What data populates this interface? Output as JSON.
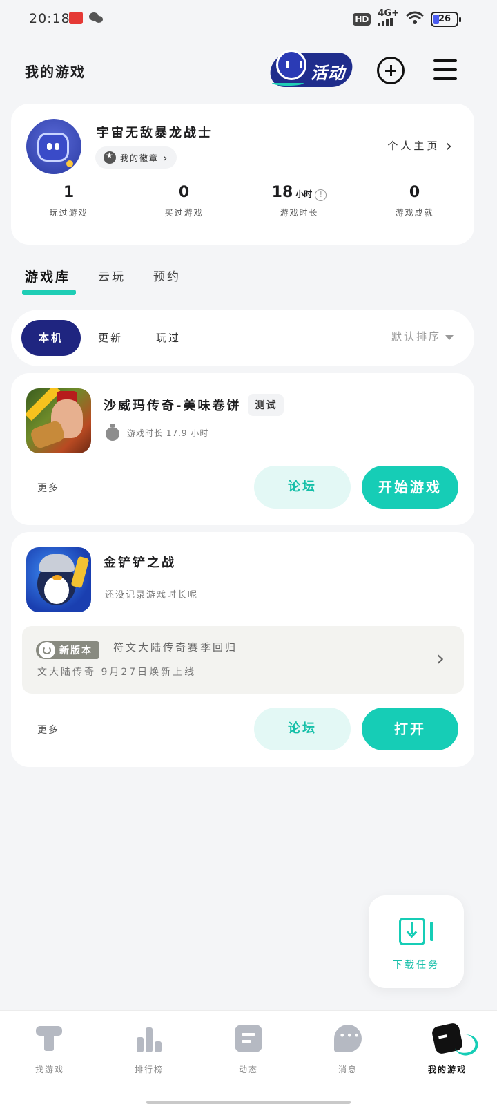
{
  "status_bar": {
    "time": "20:18",
    "hd": "HD",
    "network": "4G+",
    "battery": "26"
  },
  "header": {
    "title": "我的游戏",
    "activity_label": "活动"
  },
  "profile": {
    "username": "宇宙无敌暴龙战士",
    "badge_label": "我的徽章",
    "homepage_label": "个人主页",
    "stats": [
      {
        "value": "1",
        "unit": "",
        "label": "玩过游戏"
      },
      {
        "value": "0",
        "unit": "",
        "label": "买过游戏"
      },
      {
        "value": "18",
        "unit": "小时",
        "label": "游戏时长"
      },
      {
        "value": "0",
        "unit": "",
        "label": "游戏成就"
      }
    ]
  },
  "tabs": [
    "游戏库",
    "云玩",
    "预约"
  ],
  "filters": {
    "chips": [
      "本机",
      "更新",
      "玩过"
    ],
    "sort_label": "默认排序"
  },
  "games": [
    {
      "name": "沙威玛传奇-美味卷饼",
      "tag": "测试",
      "playtime": "游戏时长 17.9 小时",
      "more": "更多",
      "forum": "论坛",
      "action": "开始游戏"
    },
    {
      "name": "金铲铲之战",
      "playtime": "还没记录游戏时长呢",
      "news_tag": "新版本",
      "news_title": "符文大陆传奇赛季回归",
      "news_subtitle": "文大陆传奇 9月27日焕新上线",
      "more": "更多",
      "forum": "论坛",
      "action": "打开"
    }
  ],
  "download_tasks_label": "下载任务",
  "bottom_nav": [
    {
      "label": "找游戏",
      "icon": "find-games-icon"
    },
    {
      "label": "排行榜",
      "icon": "ranking-icon"
    },
    {
      "label": "动态",
      "icon": "feed-icon"
    },
    {
      "label": "消息",
      "icon": "message-icon"
    },
    {
      "label": "我的游戏",
      "icon": "my-games-icon"
    }
  ],
  "colors": {
    "accent": "#16cdb6",
    "primary_dark": "#1f2580",
    "background": "#f4f5f7"
  }
}
